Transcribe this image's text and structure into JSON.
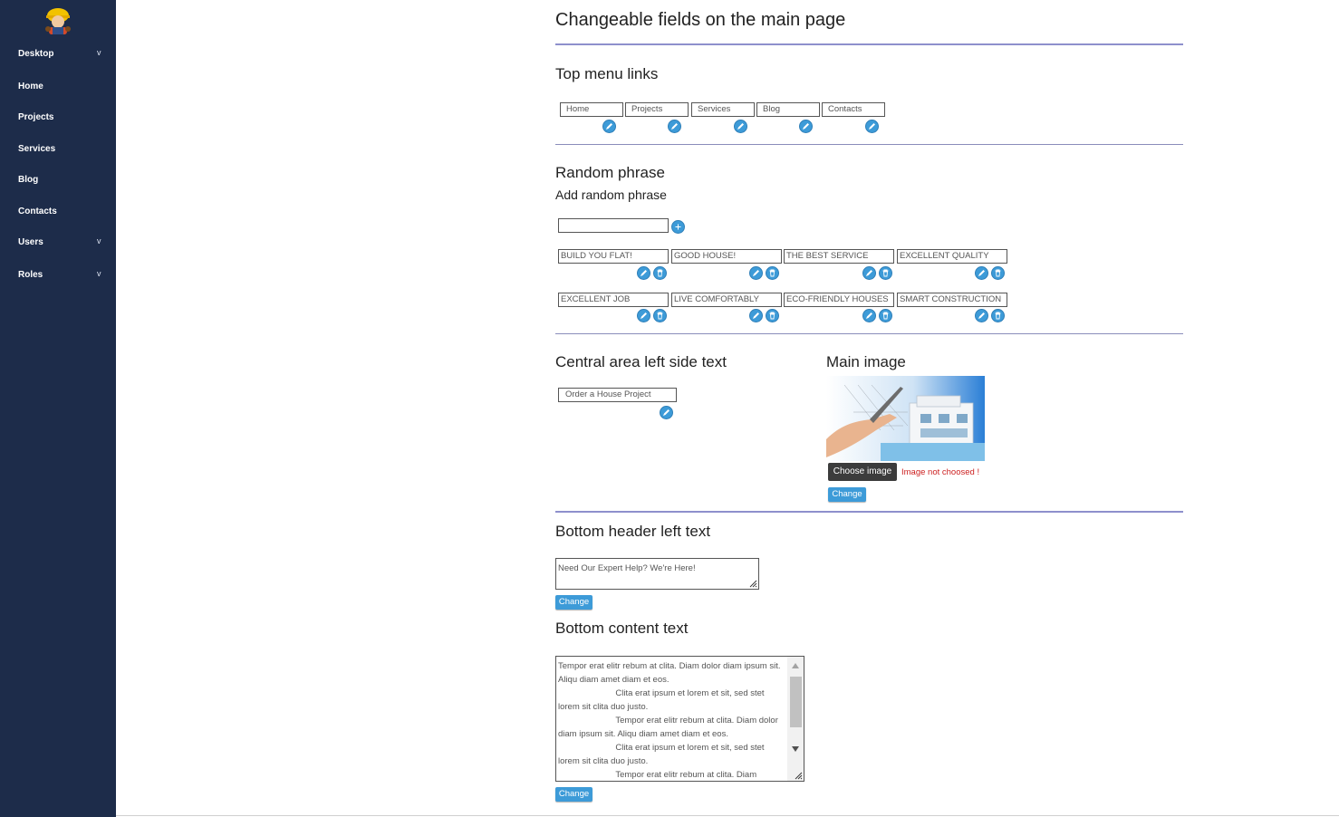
{
  "sidebar": {
    "items": [
      {
        "label": "Desktop",
        "chevron": "v"
      },
      {
        "label": "Home"
      },
      {
        "label": "Projects"
      },
      {
        "label": "Services"
      },
      {
        "label": "Blog"
      },
      {
        "label": "Contacts"
      },
      {
        "label": "Users",
        "chevron": "v"
      },
      {
        "label": "Roles",
        "chevron": "v"
      }
    ]
  },
  "page_title": "Changeable fields on the main page",
  "top_menu": {
    "heading": "Top menu links",
    "links": [
      "Home",
      "Projects",
      "Services",
      "Blog",
      "Contacts"
    ]
  },
  "random_phrase": {
    "heading": "Random phrase",
    "add_heading": "Add random phrase",
    "input_value": "",
    "phrases_row1": [
      "BUILD YOU FLAT!",
      "GOOD HOUSE!",
      "THE BEST SERVICE",
      "EXCELLENT QUALITY"
    ],
    "phrases_row2": [
      "EXCELLENT JOB",
      "LIVE COMFORTABLY",
      "ECO-FRIENDLY HOUSES",
      "SMART CONSTRUCTION"
    ]
  },
  "central": {
    "heading": "Central area left side text",
    "value": "Order a House Project"
  },
  "main_image": {
    "heading": "Main image",
    "choose_label": "Choose image",
    "status": "Image not choosed !",
    "change_label": "Change"
  },
  "bottom_header": {
    "heading": "Bottom header left text",
    "value": "Need Our Expert Help? We're Here!",
    "change_label": "Change"
  },
  "bottom_content": {
    "heading": "Bottom content text",
    "value": "Tempor erat elitr rebum at clita. Diam dolor diam ipsum sit. Aliqu diam amet diam et eos.\n                        Clita erat ipsum et lorem et sit, sed stet lorem sit clita duo justo.\n                        Tempor erat elitr rebum at clita. Diam dolor diam ipsum sit. Aliqu diam amet diam et eos.\n                        Clita erat ipsum et lorem et sit, sed stet lorem sit clita duo justo.\n                        Tempor erat elitr rebum at clita. Diam",
    "change_label": "Change"
  },
  "colors": {
    "sidebar": "#1d2c4a",
    "accent": "#3d9bd8",
    "divider": "#8e90cc",
    "error": "#cc1f1f"
  },
  "icons": [
    "worker-logo-icon",
    "chevron-down-icon",
    "edit-pencil-icon",
    "trash-icon",
    "plus-icon"
  ]
}
